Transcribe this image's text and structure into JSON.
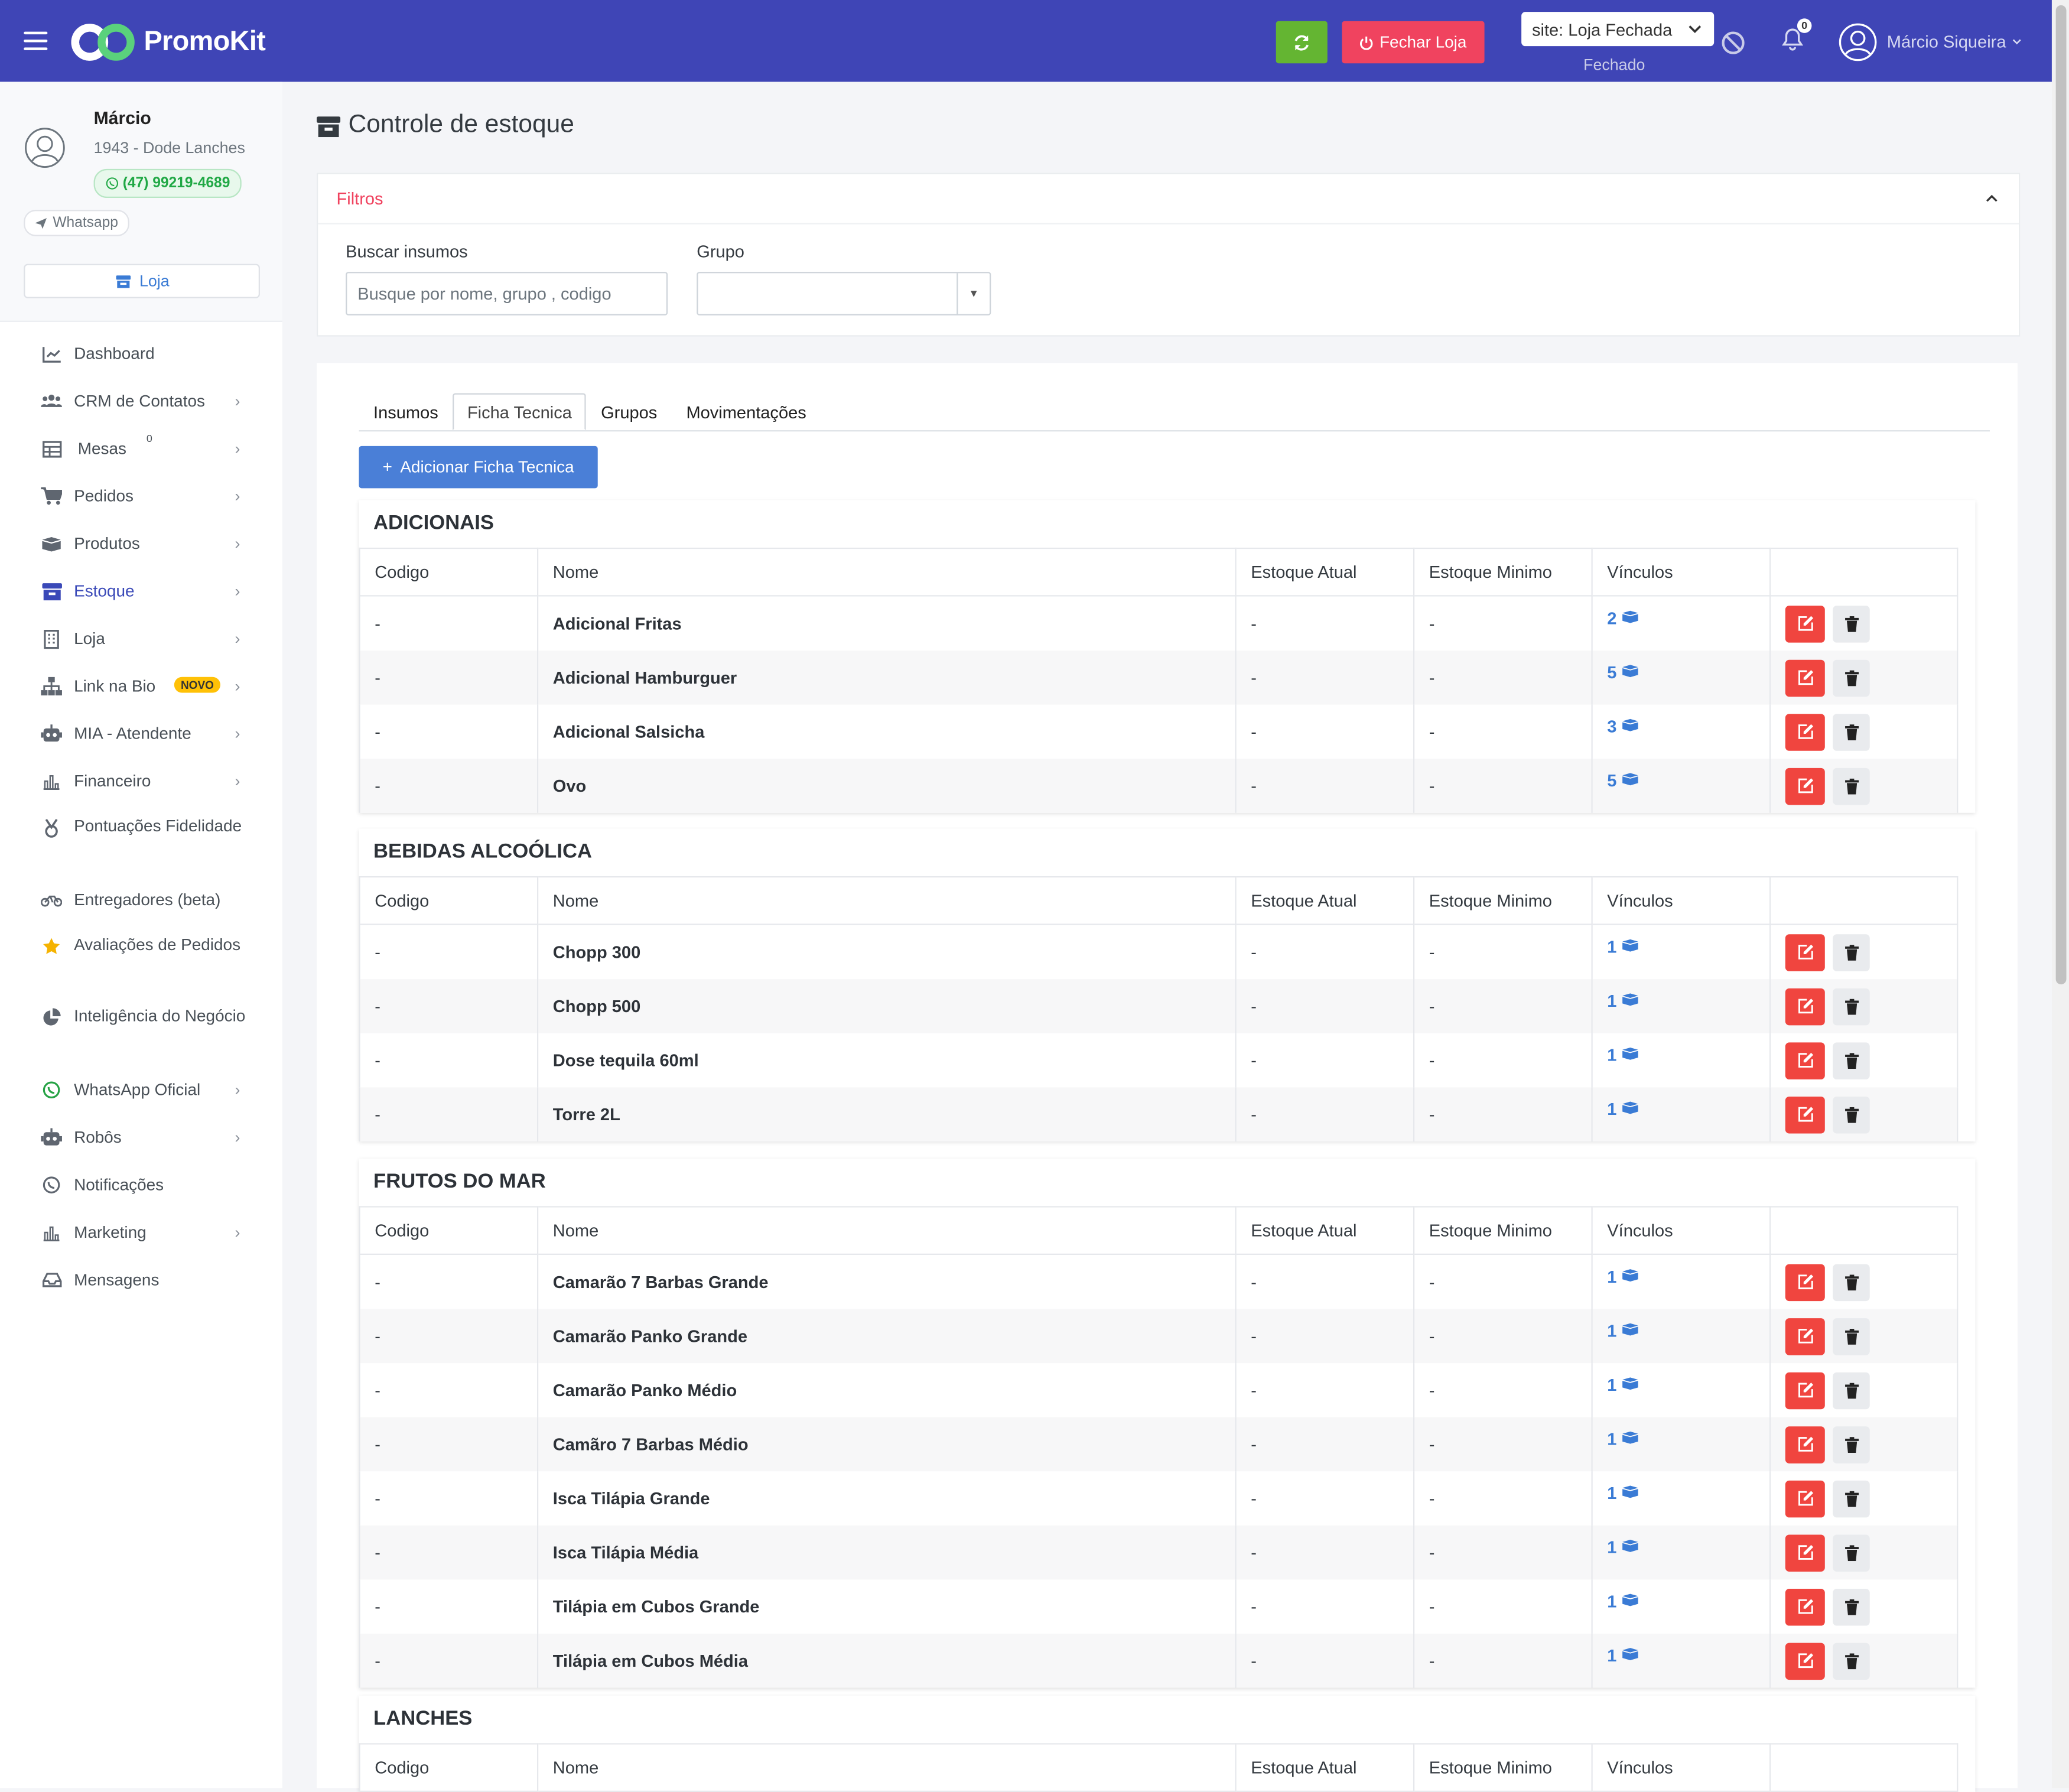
{
  "header": {
    "brand": "PromoKit",
    "close_store_label": "Fechar Loja",
    "site_select_value": "site: Loja Fechada",
    "site_status": "Fechado",
    "notifications_count": "0",
    "user_name": "Márcio Siqueira"
  },
  "profile": {
    "name": "Márcio",
    "store": "1943 - Dode Lanches",
    "phone": "(47) 99219-4689",
    "whatsapp_label": "Whatsapp",
    "store_button": "Loja"
  },
  "sidebar": {
    "items": [
      {
        "label": "Dashboard",
        "icon": "chart-line-icon",
        "arrow": false
      },
      {
        "label": "CRM de Contatos",
        "icon": "users-icon",
        "arrow": true
      },
      {
        "label": "Mesas",
        "icon": "table-icon",
        "arrow": true,
        "count": "0"
      },
      {
        "label": "Pedidos",
        "icon": "cart-icon",
        "arrow": true
      },
      {
        "label": "Produtos",
        "icon": "boxes-icon",
        "arrow": true
      },
      {
        "label": "Estoque",
        "icon": "box-icon",
        "arrow": true,
        "active": true
      },
      {
        "label": "Loja",
        "icon": "building-icon",
        "arrow": true
      },
      {
        "label": "Link na Bio",
        "icon": "sitemap-icon",
        "arrow": true,
        "badge": "NOVO"
      },
      {
        "label": "MIA - Atendente",
        "icon": "robot-icon",
        "arrow": true
      },
      {
        "label": "Financeiro",
        "icon": "bar-chart-icon",
        "arrow": true
      },
      {
        "label": "Pontuações Fidelidade",
        "icon": "medal-icon",
        "arrow": false
      },
      {
        "label": "Entregadores (beta)",
        "icon": "motorcycle-icon",
        "arrow": false
      },
      {
        "label": "Avaliações de Pedidos",
        "icon": "star-icon",
        "arrow": false
      },
      {
        "label": "Inteligência do Negócio",
        "icon": "pie-chart-icon",
        "arrow": false
      },
      {
        "label": "WhatsApp Oficial",
        "icon": "whatsapp-icon",
        "arrow": true
      },
      {
        "label": "Robôs",
        "icon": "robot-icon",
        "arrow": true
      },
      {
        "label": "Notificações",
        "icon": "whatsapp-icon",
        "arrow": false
      },
      {
        "label": "Marketing",
        "icon": "bar-chart-icon",
        "arrow": true
      },
      {
        "label": "Mensagens",
        "icon": "inbox-icon",
        "arrow": false
      }
    ]
  },
  "page": {
    "title": "Controle de estoque"
  },
  "filters": {
    "title": "Filtros",
    "search_label": "Buscar insumos",
    "search_placeholder": "Busque por nome, grupo , codigo",
    "group_label": "Grupo",
    "group_value": ""
  },
  "tabs": [
    "Insumos",
    "Ficha Tecnica",
    "Grupos",
    "Movimentações"
  ],
  "active_tab": "Ficha Tecnica",
  "add_button": "Adicionar Ficha Tecnica",
  "columns": [
    "Codigo",
    "Nome",
    "Estoque Atual",
    "Estoque Minimo",
    "Vínculos",
    ""
  ],
  "groups": [
    {
      "name": "ADICIONAIS",
      "rows": [
        {
          "codigo": "-",
          "nome": "Adicional Fritas",
          "atual": "-",
          "minimo": "-",
          "vinculos": "2"
        },
        {
          "codigo": "-",
          "nome": "Adicional Hamburguer",
          "atual": "-",
          "minimo": "-",
          "vinculos": "5"
        },
        {
          "codigo": "-",
          "nome": "Adicional Salsicha",
          "atual": "-",
          "minimo": "-",
          "vinculos": "3"
        },
        {
          "codigo": "-",
          "nome": "Ovo",
          "atual": "-",
          "minimo": "-",
          "vinculos": "5"
        }
      ]
    },
    {
      "name": "BEBIDAS ALCOÓLICA",
      "rows": [
        {
          "codigo": "-",
          "nome": "Chopp 300",
          "atual": "-",
          "minimo": "-",
          "vinculos": "1"
        },
        {
          "codigo": "-",
          "nome": "Chopp 500",
          "atual": "-",
          "minimo": "-",
          "vinculos": "1"
        },
        {
          "codigo": "-",
          "nome": "Dose tequila 60ml",
          "atual": "-",
          "minimo": "-",
          "vinculos": "1"
        },
        {
          "codigo": "-",
          "nome": "Torre 2L",
          "atual": "-",
          "minimo": "-",
          "vinculos": "1"
        }
      ]
    },
    {
      "name": "FRUTOS DO MAR",
      "rows": [
        {
          "codigo": "-",
          "nome": "Camarão 7 Barbas Grande",
          "atual": "-",
          "minimo": "-",
          "vinculos": "1"
        },
        {
          "codigo": "-",
          "nome": "Camarão Panko Grande",
          "atual": "-",
          "minimo": "-",
          "vinculos": "1"
        },
        {
          "codigo": "-",
          "nome": "Camarão Panko Médio",
          "atual": "-",
          "minimo": "-",
          "vinculos": "1"
        },
        {
          "codigo": "-",
          "nome": "Camãro 7 Barbas Médio",
          "atual": "-",
          "minimo": "-",
          "vinculos": "1"
        },
        {
          "codigo": "-",
          "nome": "Isca Tilápia Grande",
          "atual": "-",
          "minimo": "-",
          "vinculos": "1"
        },
        {
          "codigo": "-",
          "nome": "Isca Tilápia Média",
          "atual": "-",
          "minimo": "-",
          "vinculos": "1"
        },
        {
          "codigo": "-",
          "nome": "Tilápia em Cubos Grande",
          "atual": "-",
          "minimo": "-",
          "vinculos": "1"
        },
        {
          "codigo": "-",
          "nome": "Tilápia em Cubos Média",
          "atual": "-",
          "minimo": "-",
          "vinculos": "1"
        }
      ]
    },
    {
      "name": "LANCHES",
      "rows": []
    }
  ],
  "colors": {
    "header_bg": "#3f45b6",
    "refresh_green": "#64b532",
    "close_red": "#f0435f",
    "link_blue": "#3a7bd5",
    "edit_red": "#f0453f"
  }
}
